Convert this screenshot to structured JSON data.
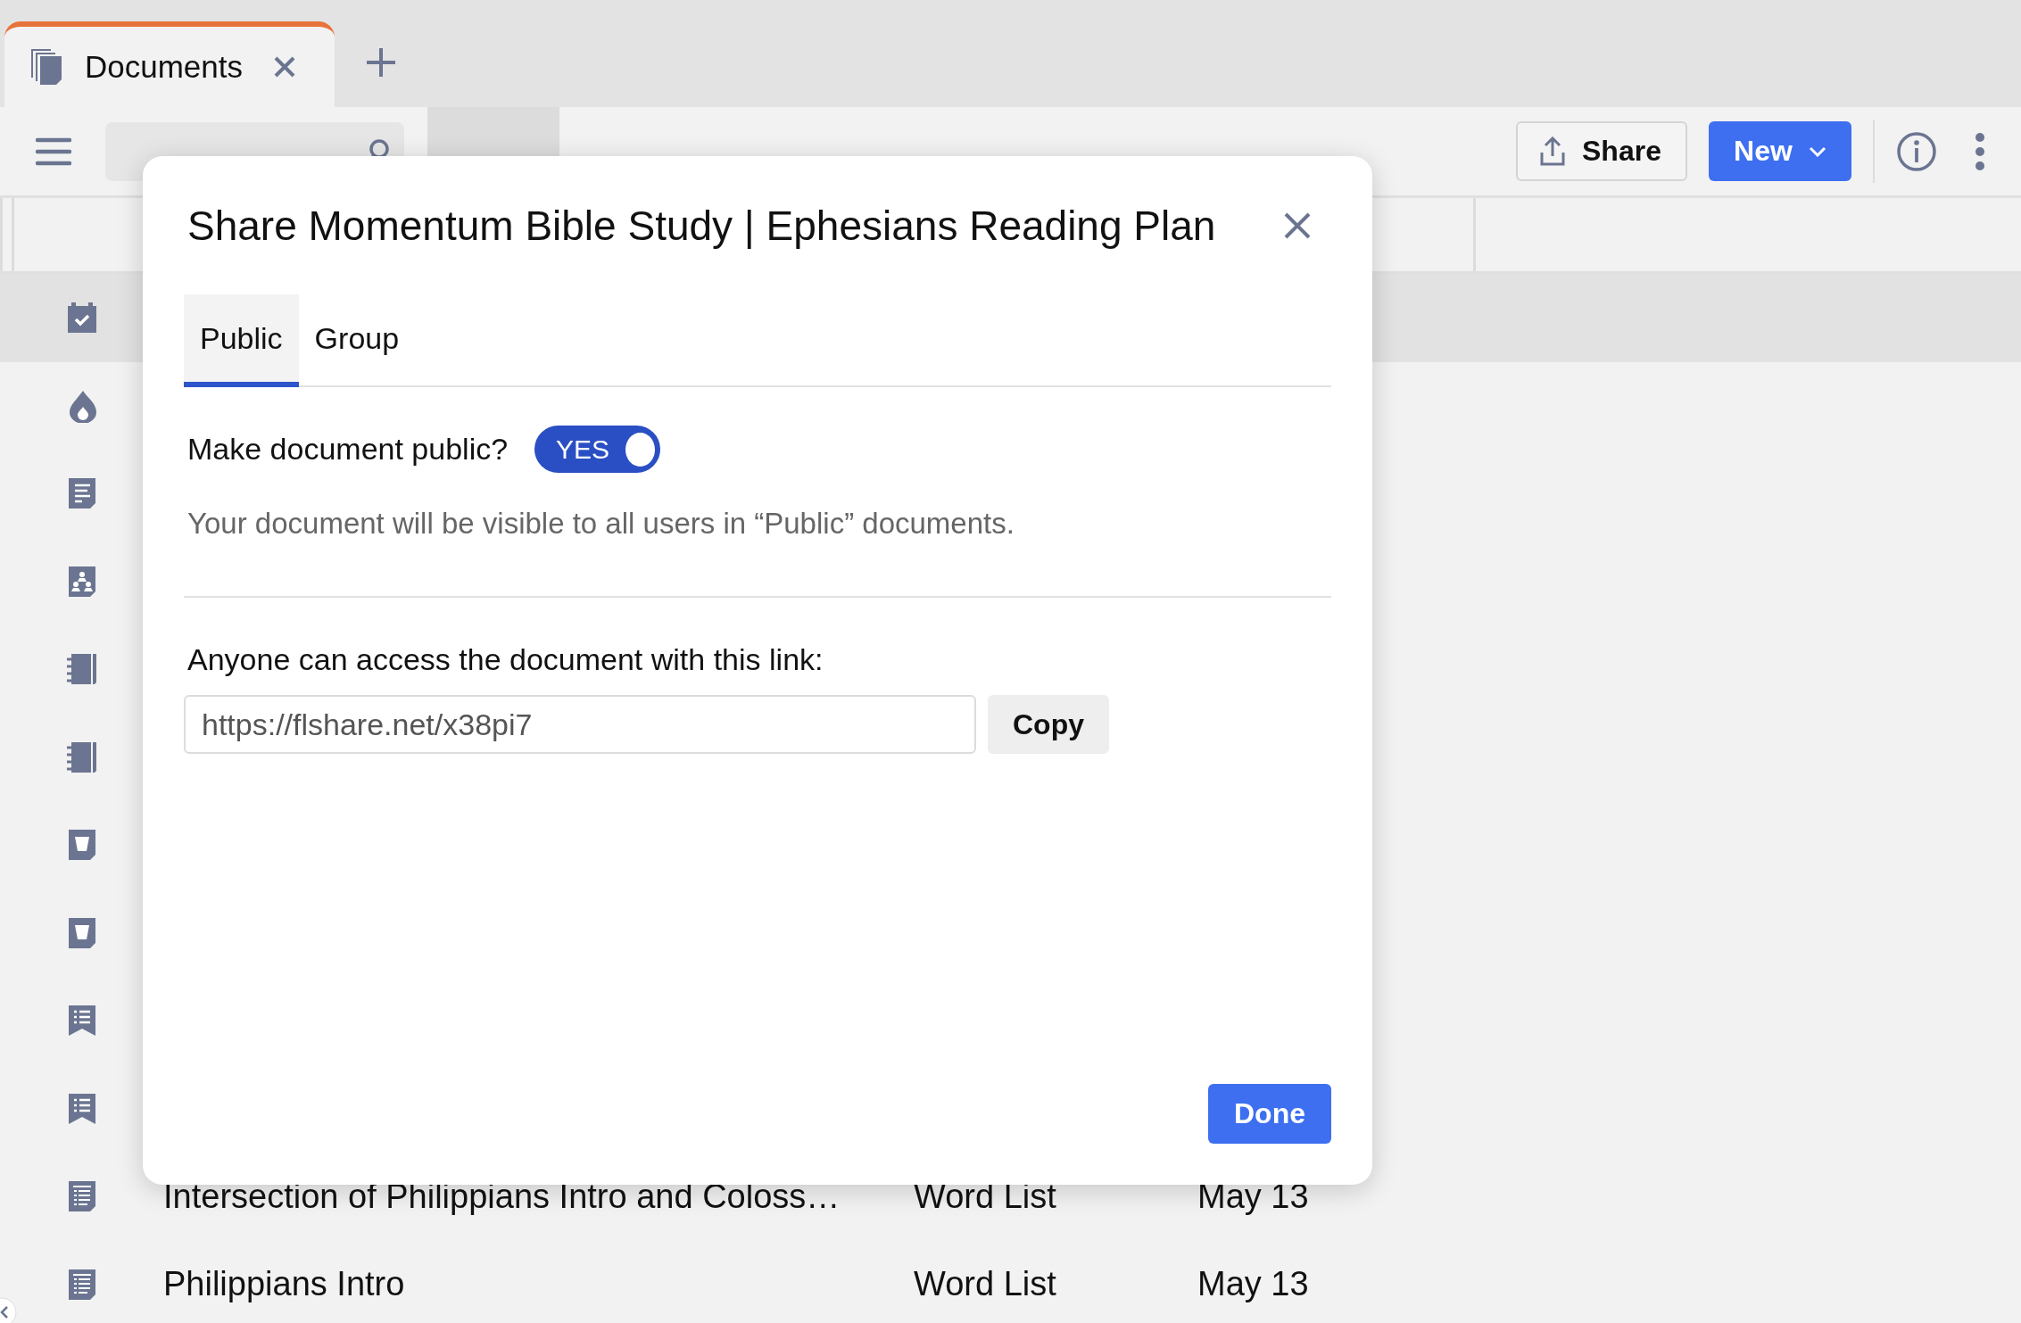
{
  "tab": {
    "title": "Documents"
  },
  "toolbar": {
    "share_button": "Share",
    "new_button": "New"
  },
  "rows": [
    {
      "kind": "calendar",
      "selected": true
    },
    {
      "kind": "flame",
      "selected": false
    },
    {
      "kind": "document",
      "selected": false
    },
    {
      "kind": "people",
      "selected": false
    },
    {
      "kind": "notebook",
      "selected": false
    },
    {
      "kind": "notebook",
      "selected": false
    },
    {
      "kind": "cup",
      "selected": false
    },
    {
      "kind": "cup",
      "selected": false
    },
    {
      "kind": "bookmark",
      "selected": false
    },
    {
      "kind": "bookmark",
      "selected": false
    },
    {
      "kind": "wordlist",
      "selected": false,
      "name": "Intersection of Philippians Intro and Coloss…",
      "type": "Word List",
      "date": "May 13"
    },
    {
      "kind": "wordlist",
      "selected": false,
      "name": "Philippians Intro",
      "type": "Word List",
      "date": "May 13"
    }
  ],
  "dialog": {
    "title": "Share Momentum Bible Study | Ephesians Reading Plan",
    "tabs": [
      {
        "label": "Public",
        "selected": true
      },
      {
        "label": "Group",
        "selected": false
      }
    ],
    "public_toggle": {
      "label": "Make document public?",
      "on": true,
      "text": "YES"
    },
    "description": "Your document will be visible to all users in “Public” documents.",
    "link_label": "Anyone can access the document with this link:",
    "link": {
      "value": "https://flshare.net/x38pi7"
    },
    "copy_button": "Copy",
    "done_button": "Done"
  }
}
